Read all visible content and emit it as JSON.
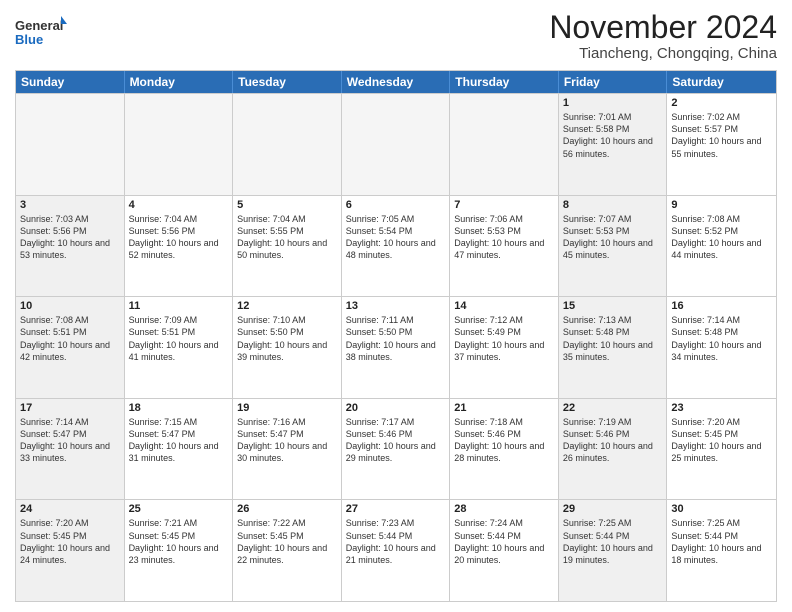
{
  "logo": {
    "general": "General",
    "blue": "Blue"
  },
  "header": {
    "month": "November 2024",
    "location": "Tiancheng, Chongqing, China"
  },
  "days_of_week": [
    "Sunday",
    "Monday",
    "Tuesday",
    "Wednesday",
    "Thursday",
    "Friday",
    "Saturday"
  ],
  "rows": [
    [
      {
        "day": "",
        "info": "",
        "empty": true
      },
      {
        "day": "",
        "info": "",
        "empty": true
      },
      {
        "day": "",
        "info": "",
        "empty": true
      },
      {
        "day": "",
        "info": "",
        "empty": true
      },
      {
        "day": "",
        "info": "",
        "empty": true
      },
      {
        "day": "1",
        "info": "Sunrise: 7:01 AM\nSunset: 5:58 PM\nDaylight: 10 hours and 56 minutes.",
        "shaded": true
      },
      {
        "day": "2",
        "info": "Sunrise: 7:02 AM\nSunset: 5:57 PM\nDaylight: 10 hours and 55 minutes.",
        "shaded": false
      }
    ],
    [
      {
        "day": "3",
        "info": "Sunrise: 7:03 AM\nSunset: 5:56 PM\nDaylight: 10 hours and 53 minutes.",
        "shaded": true
      },
      {
        "day": "4",
        "info": "Sunrise: 7:04 AM\nSunset: 5:56 PM\nDaylight: 10 hours and 52 minutes.",
        "shaded": false
      },
      {
        "day": "5",
        "info": "Sunrise: 7:04 AM\nSunset: 5:55 PM\nDaylight: 10 hours and 50 minutes.",
        "shaded": false
      },
      {
        "day": "6",
        "info": "Sunrise: 7:05 AM\nSunset: 5:54 PM\nDaylight: 10 hours and 48 minutes.",
        "shaded": false
      },
      {
        "day": "7",
        "info": "Sunrise: 7:06 AM\nSunset: 5:53 PM\nDaylight: 10 hours and 47 minutes.",
        "shaded": false
      },
      {
        "day": "8",
        "info": "Sunrise: 7:07 AM\nSunset: 5:53 PM\nDaylight: 10 hours and 45 minutes.",
        "shaded": true
      },
      {
        "day": "9",
        "info": "Sunrise: 7:08 AM\nSunset: 5:52 PM\nDaylight: 10 hours and 44 minutes.",
        "shaded": false
      }
    ],
    [
      {
        "day": "10",
        "info": "Sunrise: 7:08 AM\nSunset: 5:51 PM\nDaylight: 10 hours and 42 minutes.",
        "shaded": true
      },
      {
        "day": "11",
        "info": "Sunrise: 7:09 AM\nSunset: 5:51 PM\nDaylight: 10 hours and 41 minutes.",
        "shaded": false
      },
      {
        "day": "12",
        "info": "Sunrise: 7:10 AM\nSunset: 5:50 PM\nDaylight: 10 hours and 39 minutes.",
        "shaded": false
      },
      {
        "day": "13",
        "info": "Sunrise: 7:11 AM\nSunset: 5:50 PM\nDaylight: 10 hours and 38 minutes.",
        "shaded": false
      },
      {
        "day": "14",
        "info": "Sunrise: 7:12 AM\nSunset: 5:49 PM\nDaylight: 10 hours and 37 minutes.",
        "shaded": false
      },
      {
        "day": "15",
        "info": "Sunrise: 7:13 AM\nSunset: 5:48 PM\nDaylight: 10 hours and 35 minutes.",
        "shaded": true
      },
      {
        "day": "16",
        "info": "Sunrise: 7:14 AM\nSunset: 5:48 PM\nDaylight: 10 hours and 34 minutes.",
        "shaded": false
      }
    ],
    [
      {
        "day": "17",
        "info": "Sunrise: 7:14 AM\nSunset: 5:47 PM\nDaylight: 10 hours and 33 minutes.",
        "shaded": true
      },
      {
        "day": "18",
        "info": "Sunrise: 7:15 AM\nSunset: 5:47 PM\nDaylight: 10 hours and 31 minutes.",
        "shaded": false
      },
      {
        "day": "19",
        "info": "Sunrise: 7:16 AM\nSunset: 5:47 PM\nDaylight: 10 hours and 30 minutes.",
        "shaded": false
      },
      {
        "day": "20",
        "info": "Sunrise: 7:17 AM\nSunset: 5:46 PM\nDaylight: 10 hours and 29 minutes.",
        "shaded": false
      },
      {
        "day": "21",
        "info": "Sunrise: 7:18 AM\nSunset: 5:46 PM\nDaylight: 10 hours and 28 minutes.",
        "shaded": false
      },
      {
        "day": "22",
        "info": "Sunrise: 7:19 AM\nSunset: 5:46 PM\nDaylight: 10 hours and 26 minutes.",
        "shaded": true
      },
      {
        "day": "23",
        "info": "Sunrise: 7:20 AM\nSunset: 5:45 PM\nDaylight: 10 hours and 25 minutes.",
        "shaded": false
      }
    ],
    [
      {
        "day": "24",
        "info": "Sunrise: 7:20 AM\nSunset: 5:45 PM\nDaylight: 10 hours and 24 minutes.",
        "shaded": true
      },
      {
        "day": "25",
        "info": "Sunrise: 7:21 AM\nSunset: 5:45 PM\nDaylight: 10 hours and 23 minutes.",
        "shaded": false
      },
      {
        "day": "26",
        "info": "Sunrise: 7:22 AM\nSunset: 5:45 PM\nDaylight: 10 hours and 22 minutes.",
        "shaded": false
      },
      {
        "day": "27",
        "info": "Sunrise: 7:23 AM\nSunset: 5:44 PM\nDaylight: 10 hours and 21 minutes.",
        "shaded": false
      },
      {
        "day": "28",
        "info": "Sunrise: 7:24 AM\nSunset: 5:44 PM\nDaylight: 10 hours and 20 minutes.",
        "shaded": false
      },
      {
        "day": "29",
        "info": "Sunrise: 7:25 AM\nSunset: 5:44 PM\nDaylight: 10 hours and 19 minutes.",
        "shaded": true
      },
      {
        "day": "30",
        "info": "Sunrise: 7:25 AM\nSunset: 5:44 PM\nDaylight: 10 hours and 18 minutes.",
        "shaded": false
      }
    ]
  ]
}
